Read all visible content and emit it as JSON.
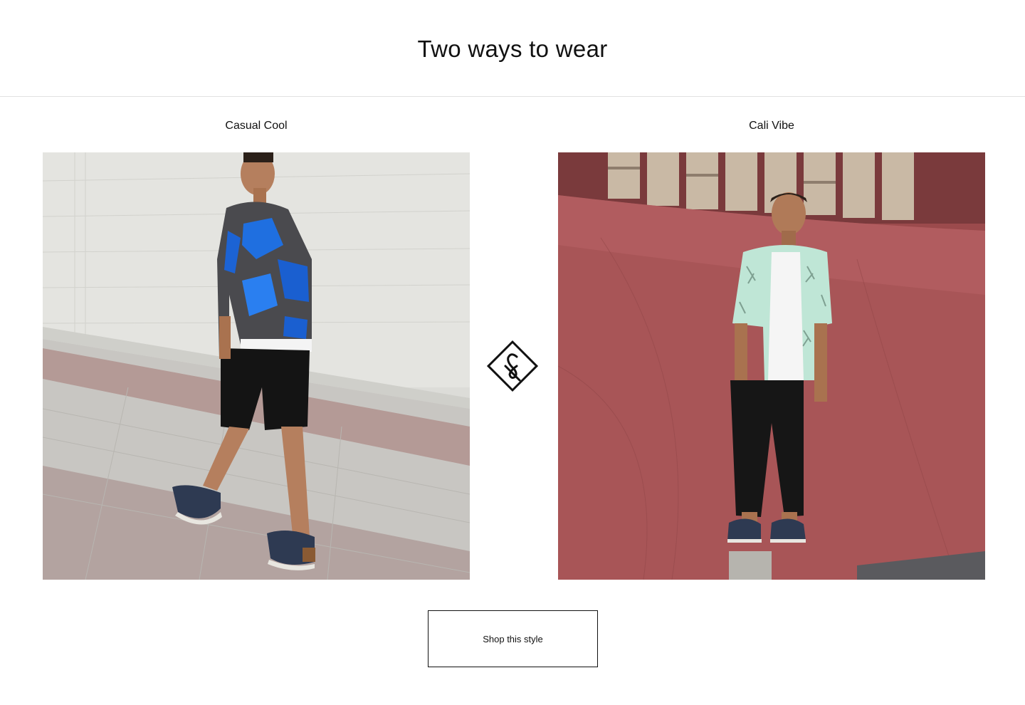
{
  "page": {
    "title": "Two ways to wear"
  },
  "looks": [
    {
      "label": "Casual Cool",
      "image_description_icon": "model-in-blue-camo-sweater-image"
    },
    {
      "label": "Cali Vibe",
      "image_description_icon": "model-in-palm-print-shirt-image"
    }
  ],
  "divider_icon": "ampersand-diamond-icon",
  "cta": {
    "label": "Shop this style"
  },
  "colors": {
    "text": "#111111",
    "border": "#e2e2e2",
    "background": "#ffffff"
  }
}
